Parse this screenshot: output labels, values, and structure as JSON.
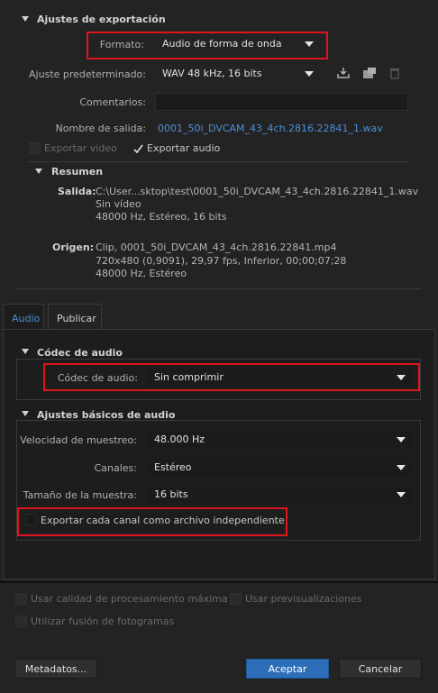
{
  "export_settings": {
    "header": "Ajustes de exportación",
    "format_label": "Formato:",
    "format_value": "Audio de forma de onda",
    "preset_label": "Ajuste predeterminado:",
    "preset_value": "WAV 48 kHz, 16 bits",
    "comments_label": "Comentarios:",
    "comments_value": "",
    "output_name_label": "Nombre de salida:",
    "output_name_value": "0001_50i_DVCAM_43_4ch.2816.22841_1.wav",
    "export_video_label": "Exportar vídeo",
    "export_video_checked": false,
    "export_audio_label": "Exportar audio",
    "export_audio_checked": true
  },
  "summary": {
    "header": "Resumen",
    "output_label": "Salida:",
    "output_lines": [
      "C:\\User...sktop\\test\\0001_50i_DVCAM_43_4ch.2816.22841_1.wav",
      "Sin vídeo",
      "48000 Hz, Estéreo, 16 bits"
    ],
    "source_label": "Origen:",
    "source_lines": [
      "Clip, 0001_50i_DVCAM_43_4ch.2816.22841.mp4",
      "720x480 (0,9091), 29,97 fps, Inferior, 00;00;07;28",
      "48000 Hz, Estéreo"
    ]
  },
  "tabs": [
    {
      "label": "Audio",
      "active": true
    },
    {
      "label": "Publicar",
      "active": false
    }
  ],
  "audio_codec": {
    "header": "Códec de audio",
    "codec_label": "Códec de audio:",
    "codec_value": "Sin comprimir"
  },
  "basic_audio": {
    "header": "Ajustes básicos de audio",
    "sample_rate_label": "Velocidad de muestreo:",
    "sample_rate_value": "48.000 Hz",
    "channels_label": "Canales:",
    "channels_value": "Estéreo",
    "sample_size_label": "Tamaño de la muestra:",
    "sample_size_value": "16 bits",
    "export_channels_label": "Exportar cada canal como archivo independiente",
    "export_channels_checked": false
  },
  "bottom_options": {
    "max_quality_label": "Usar calidad de procesamiento máxima",
    "previews_label": "Usar previsualizaciones",
    "frame_blending_label": "Utilizar fusión de fotogramas"
  },
  "buttons": {
    "metadata": "Metadatos...",
    "accept": "Aceptar",
    "cancel": "Cancelar"
  },
  "colors": {
    "accent": "#2d6eb8",
    "highlight_box": "#e0141e",
    "link": "#4a90d9"
  }
}
